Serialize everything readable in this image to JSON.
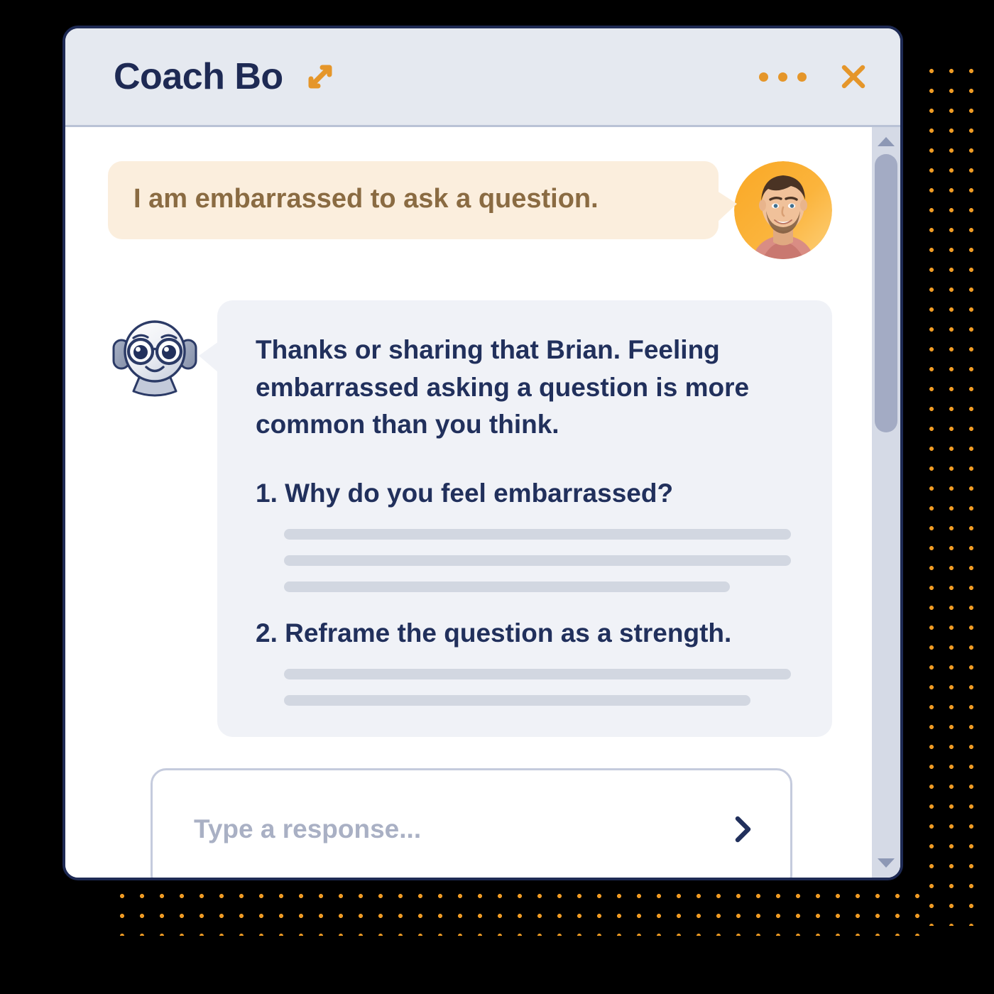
{
  "window": {
    "title": "Coach Bo",
    "expand_icon": "expand-diagonal-icon",
    "menu_icon": "kebab-menu-icon",
    "close_icon": "close-x-icon",
    "border_color": "#1e2a54",
    "titlebar_color": "#e5e9f0",
    "accent_color": "#e5962a"
  },
  "messages": {
    "user": {
      "text": "I am embarrassed to ask a question.",
      "avatar_name": "user-photo-avatar",
      "bubble_color": "#fbeedd",
      "text_color": "#8a6b42"
    },
    "bot": {
      "avatar_name": "robot-mascot-avatar",
      "bubble_color": "#f0f2f7",
      "text_color": "#21305c",
      "paragraph": "Thanks or sharing that Brian. Feeling embarrassed asking a question is more common than you think.",
      "items": [
        {
          "title": "1. Why do you feel embarrassed?",
          "skeleton_widths": [
            "100%",
            "100%",
            "88%"
          ]
        },
        {
          "title": "2. Reframe the question as a strength.",
          "skeleton_widths": [
            "100%",
            "92%"
          ]
        }
      ]
    }
  },
  "composer": {
    "placeholder": "Type a response...",
    "value": "",
    "send_icon": "chevron-right-icon"
  },
  "scrollbar": {
    "up_icon": "caret-up-icon",
    "down_icon": "caret-down-icon",
    "thumb_size_percent": "40%",
    "thumb_position_percent": "0%"
  },
  "decor": {
    "dot_color": "#ef9b24",
    "background_color": "#000000"
  }
}
